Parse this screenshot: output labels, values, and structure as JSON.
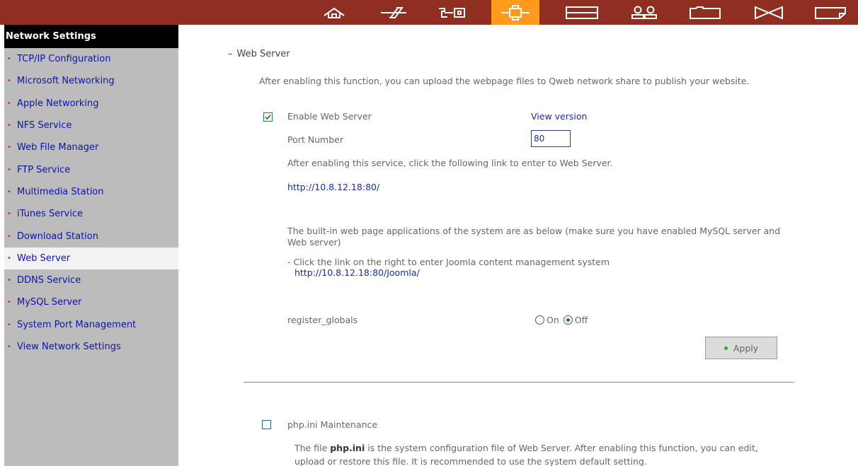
{
  "toolbar": {
    "icons": [
      "home-icon",
      "quick-config-icon",
      "system-admin-icon",
      "network-icon",
      "disk-icon",
      "users-icon",
      "share-icon",
      "applications-icon",
      "backup-icon"
    ],
    "active": "network-icon",
    "colors": {
      "bar": "#8e2f22",
      "active": "#ff9a1e"
    }
  },
  "sidebar": {
    "title": "Network Settings",
    "items": [
      {
        "label": "TCP/IP Configuration"
      },
      {
        "label": "Microsoft Networking"
      },
      {
        "label": "Apple Networking"
      },
      {
        "label": "NFS Service"
      },
      {
        "label": "Web File Manager"
      },
      {
        "label": "FTP Service"
      },
      {
        "label": "Multimedia Station"
      },
      {
        "label": "iTunes Service"
      },
      {
        "label": "Download Station"
      },
      {
        "label": "Web Server",
        "selected": true
      },
      {
        "label": "DDNS Service"
      },
      {
        "label": "MySQL Server"
      },
      {
        "label": "System Port Management"
      },
      {
        "label": "View Network Settings"
      }
    ]
  },
  "main": {
    "section_title": "Web Server",
    "description": "After enabling this function, you can upload the webpage files to Qweb network share to publish your website.",
    "enable_label": "Enable Web Server",
    "enable_checked": true,
    "view_version": "View version",
    "port_label": "Port Number",
    "port_value": "80",
    "enter_hint": "After enabling this service, click the following link to enter to Web Server.",
    "server_link": "http://10.8.12.18:80/",
    "apps_note": "The built-in web page applications of the system are as below (make sure you have enabled MySQL server and Web server)",
    "joomla_note": "- Click the link on the right to enter Joomla content management system",
    "joomla_link": "http://10.8.12.18:80/Joomla/",
    "register_globals_label": "register_globals",
    "radio_on": "On",
    "radio_off": "Off",
    "register_globals_value": "Off",
    "apply_label": "Apply",
    "phpini_label": "php.ini Maintenance",
    "phpini_checked": false,
    "phpini_prefix": "The file ",
    "phpini_file": "php.ini",
    "phpini_desc": " is the system configuration file of Web Server. After enabling this function, you can edit, upload or restore this file. It is recommended to use the system default setting."
  }
}
